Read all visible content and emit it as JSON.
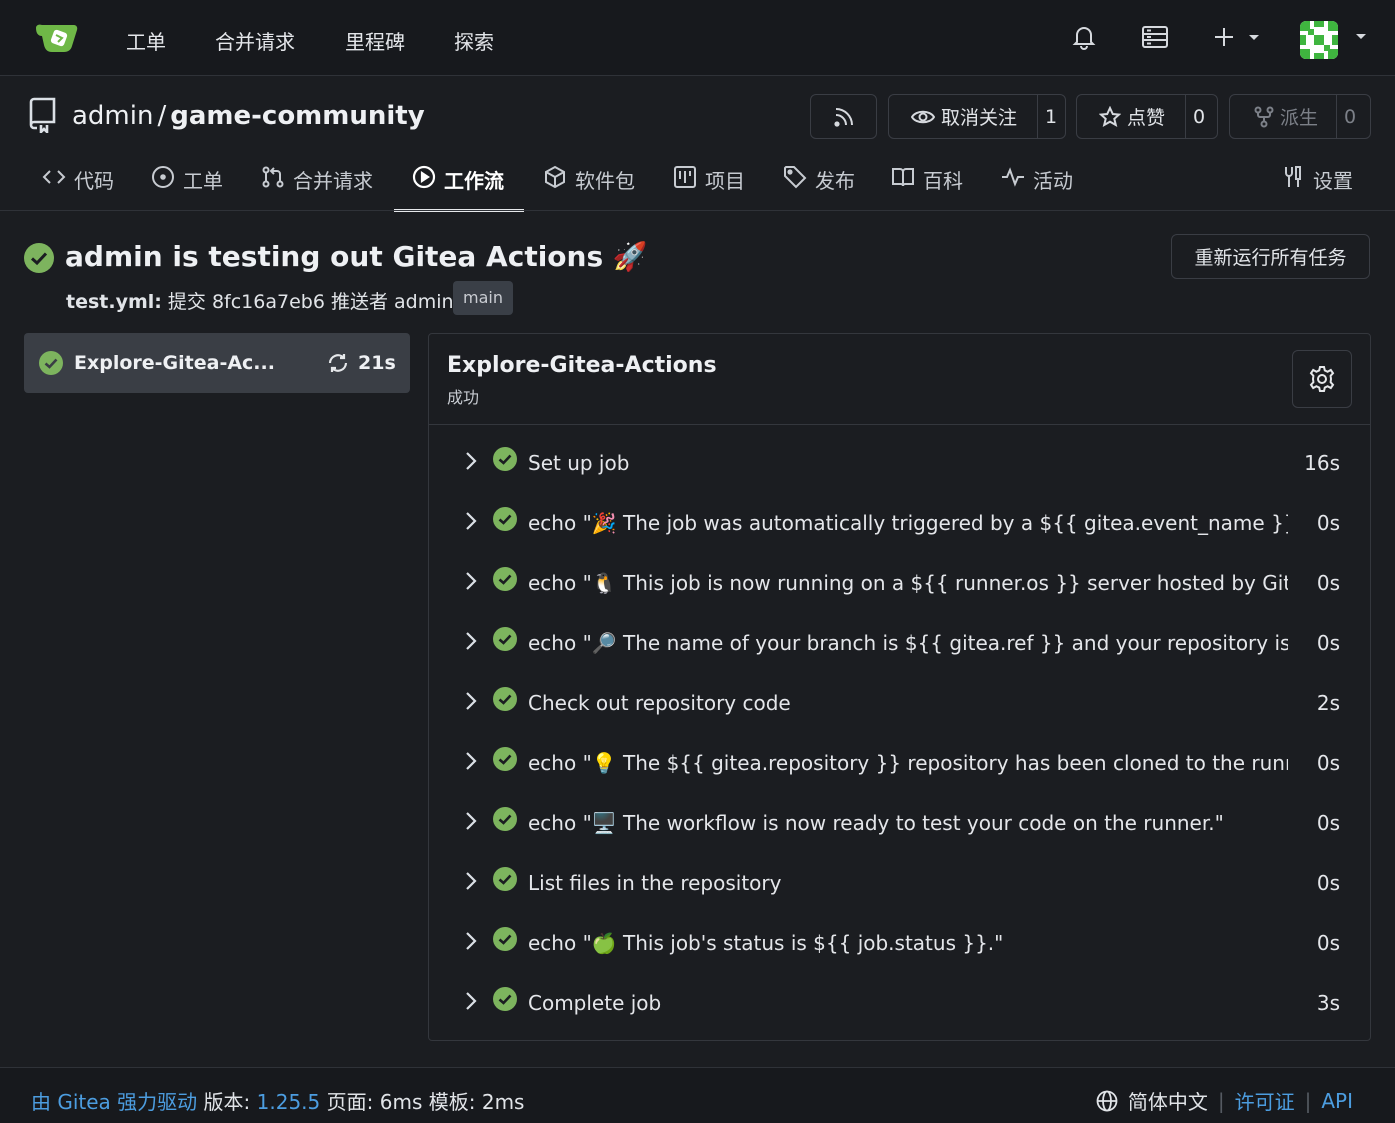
{
  "topnav": {
    "links": [
      "工单",
      "合并请求",
      "里程碑",
      "探索"
    ],
    "icons": [
      "bell-icon",
      "server-icon",
      "plus-icon",
      "avatar"
    ]
  },
  "repo": {
    "owner": "admin",
    "separator": "/",
    "name": "game-community",
    "watch_label": "取消关注",
    "watch_count": "1",
    "star_label": "点赞",
    "star_count": "0",
    "fork_label": "派生",
    "fork_count": "0"
  },
  "tabs": [
    {
      "label": "代码",
      "icon": "code-icon"
    },
    {
      "label": "工单",
      "icon": "issue-icon"
    },
    {
      "label": "合并请求",
      "icon": "pull-request-icon"
    },
    {
      "label": "工作流",
      "icon": "play-icon",
      "active": true
    },
    {
      "label": "软件包",
      "icon": "package-icon"
    },
    {
      "label": "项目",
      "icon": "project-icon"
    },
    {
      "label": "发布",
      "icon": "tag-icon"
    },
    {
      "label": "百科",
      "icon": "book-icon"
    },
    {
      "label": "活动",
      "icon": "pulse-icon"
    },
    {
      "label": "设置",
      "icon": "tools-icon"
    }
  ],
  "run": {
    "title": "admin is testing out Gitea Actions 🚀",
    "subtitle": "test.yml: 提交 8fc16a7eb6 推送者 admin",
    "subtitle_file": "test.yml:",
    "subtitle_rest": "提交 8fc16a7eb6 推送者 admin",
    "branch": "main",
    "rerun_label": "重新运行所有任务"
  },
  "job": {
    "name": "Explore-Gitea-Ac...",
    "duration": "21s"
  },
  "panel": {
    "title": "Explore-Gitea-Actions",
    "status": "成功"
  },
  "steps": [
    {
      "name": "Set up job",
      "duration": "16s"
    },
    {
      "name": "echo \"🎉 The job was automatically triggered by a ${{ gitea.event_name }} event.\"",
      "duration": "0s"
    },
    {
      "name": "echo \"🐧 This job is now running on a ${{ runner.os }} server hosted by Gitea!\"",
      "duration": "0s"
    },
    {
      "name": "echo \"🔎 The name of your branch is ${{ gitea.ref }} and your repository is ${{ git...",
      "duration": "0s"
    },
    {
      "name": "Check out repository code",
      "duration": "2s"
    },
    {
      "name": "echo \"💡 The ${{ gitea.repository }} repository has been cloned to the runner.\"",
      "duration": "0s"
    },
    {
      "name": "echo \"🖥️ The workflow is now ready to test your code on the runner.\"",
      "duration": "0s"
    },
    {
      "name": "List files in the repository",
      "duration": "0s"
    },
    {
      "name": "echo \"🍏 This job's status is ${{ job.status }}.\"",
      "duration": "0s"
    },
    {
      "name": "Complete job",
      "duration": "3s"
    }
  ],
  "footer": {
    "powered": "由 Gitea 强力驱动",
    "version_label": "版本:",
    "version": "1.25.5",
    "page_label": "页面:",
    "page_time": "6ms",
    "template_label": "模板:",
    "template_time": "2ms",
    "language": "简体中文",
    "license": "许可证",
    "api": "API"
  },
  "colors": {
    "success": "#7db45e",
    "link": "#4c9de0",
    "background": "#1b1d21"
  }
}
